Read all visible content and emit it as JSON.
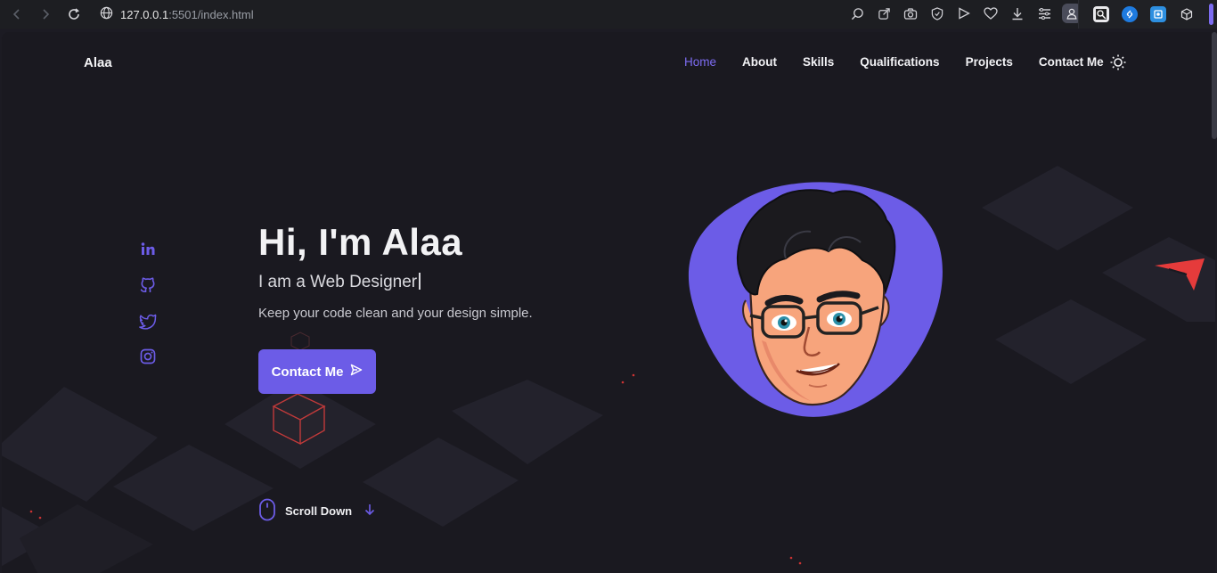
{
  "browser": {
    "url_host": "127.0.0.1",
    "url_path": ":5501/index.html"
  },
  "site": {
    "logo": "Alaa",
    "nav": [
      {
        "label": "Home",
        "active": true
      },
      {
        "label": "About",
        "active": false
      },
      {
        "label": "Skills",
        "active": false
      },
      {
        "label": "Qualifications",
        "active": false
      },
      {
        "label": "Projects",
        "active": false
      },
      {
        "label": "Contact Me",
        "active": false
      }
    ],
    "theme_icon": "sun-icon"
  },
  "social": [
    {
      "icon": "linkedin-icon"
    },
    {
      "icon": "github-icon"
    },
    {
      "icon": "twitter-icon"
    },
    {
      "icon": "instagram-icon"
    }
  ],
  "hero": {
    "title": "Hi, I'm Alaa",
    "subtitle": "I am a Web Designer",
    "description": "Keep your code clean and your design simple.",
    "cta_label": "Contact Me",
    "scroll_label": "Scroll Down"
  },
  "colors": {
    "accent": "#6c5ce7",
    "background": "#1a1920",
    "text": "#f2f2f4"
  }
}
